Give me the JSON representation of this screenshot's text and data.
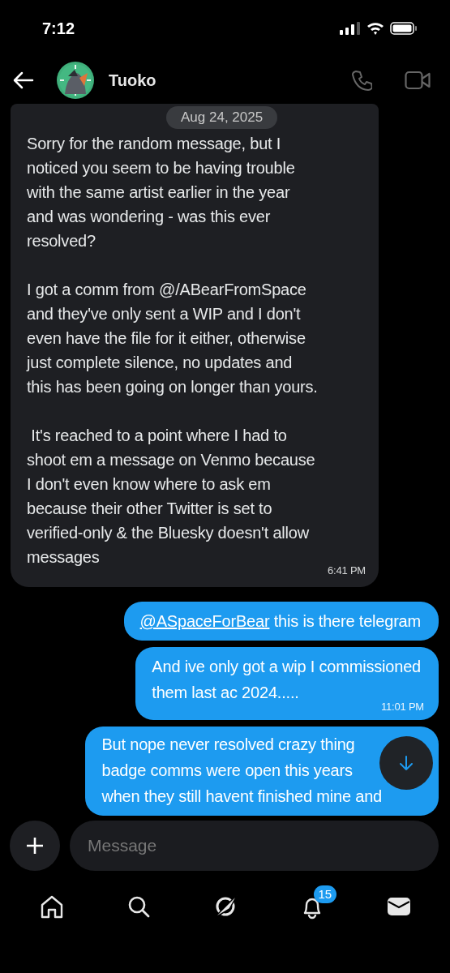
{
  "status_bar": {
    "time": "7:12"
  },
  "header": {
    "name": "Tuoko"
  },
  "date_pill": "Aug 24, 2025",
  "messages": [
    {
      "kind": "incoming",
      "paragraphs": [
        [
          "Sorry for the random message, but I",
          "noticed you seem to be having trouble",
          "with the same artist earlier in the year",
          "and was wondering - was this ever",
          "resolved?"
        ],
        [
          "I got a comm from @/ABearFromSpace",
          "and they've only sent a WIP and I don't",
          "even have the file for it either, otherwise",
          "just complete silence, no updates and",
          "this has been going on longer than yours."
        ],
        [
          " It's reached to a point where I had to",
          "shoot em a message on Venmo because",
          "I don't even know where to ask em",
          "because their other Twitter is set to",
          "verified-only & the Bluesky doesn't allow",
          "messages"
        ]
      ],
      "time": "6:41 PM"
    },
    {
      "kind": "outgoing",
      "link": "@ASpaceForBear",
      "paragraphs": [
        [
          " this is there telegram"
        ]
      ]
    },
    {
      "kind": "outgoing",
      "paragraphs": [
        [
          "And ive only got a wip I commissioned",
          "them last ac 2024....."
        ]
      ],
      "time": "11:01 PM"
    },
    {
      "kind": "outgoing",
      "paragraphs": [
        [
          "But nope never resolved crazy thing",
          "badge comms were open this years",
          "when they still havent finished mine and"
        ]
      ]
    }
  ],
  "composer": {
    "placeholder": "Message"
  },
  "nav": [
    {
      "kind": "home",
      "selected": false
    },
    {
      "kind": "search",
      "selected": false
    },
    {
      "kind": "grok",
      "selected": false
    },
    {
      "kind": "bell",
      "selected": false,
      "badge": "15"
    },
    {
      "kind": "mail",
      "selected": true
    }
  ]
}
